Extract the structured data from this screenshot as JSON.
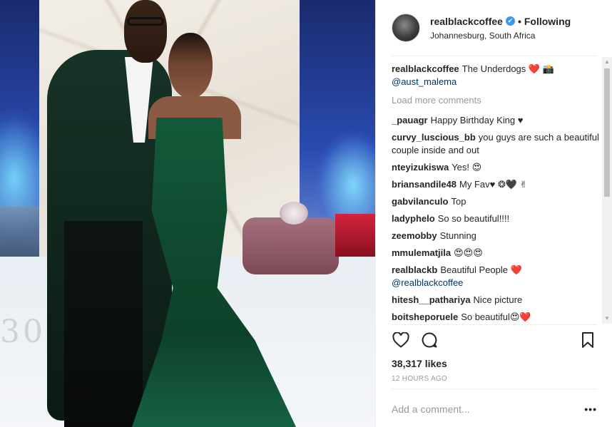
{
  "header": {
    "username": "realblackcoffee",
    "follow_status": "Following",
    "dot": "•",
    "location": "Johannesburg, South Africa",
    "verified_glyph": "✔"
  },
  "caption": {
    "user": "realblackcoffee",
    "text": "The Underdogs",
    "emoji": "❤️ 📸",
    "mention": "@aust_malema"
  },
  "load_more": "Load more comments",
  "comments": [
    {
      "user": "_pauagr",
      "text": "Happy Birthday King ♥"
    },
    {
      "user": "curvy_luscious_bb",
      "text": "you guys are such a beautiful couple inside and out"
    },
    {
      "user": "nteyizukiswa",
      "text": "Yes! 😍"
    },
    {
      "user": "briansandile48",
      "text": "My Fav♥ ❂🖤 ✌"
    },
    {
      "user": "gabvilanculo",
      "text": "Top"
    },
    {
      "user": "ladyphelo",
      "text": "So so beautiful!!!!"
    },
    {
      "user": "zeemobby",
      "text": "Stunning"
    },
    {
      "user": "mmulematjila",
      "text": "😍😍😍"
    },
    {
      "user": "realblackb",
      "text": "Beautiful People ❤️",
      "mention": "@realblackcoffee"
    },
    {
      "user": "hitesh__pathariya",
      "text": "Nice picture"
    },
    {
      "user": "boitsheporuele",
      "text": "So beautiful😍❤️"
    }
  ],
  "likes": "38,317 likes",
  "timestamp": "12 HOURS AGO",
  "add_comment": {
    "placeholder": "Add a comment..."
  },
  "more_options": "•••",
  "icons": {
    "like": "heart-icon",
    "comment": "comment-bubble-icon",
    "save": "bookmark-icon",
    "scroll_up": "▲",
    "scroll_down": "▼"
  },
  "photo_text": "30",
  "colors": {
    "link": "#003569",
    "verified": "#3897f0",
    "muted": "#999999"
  }
}
